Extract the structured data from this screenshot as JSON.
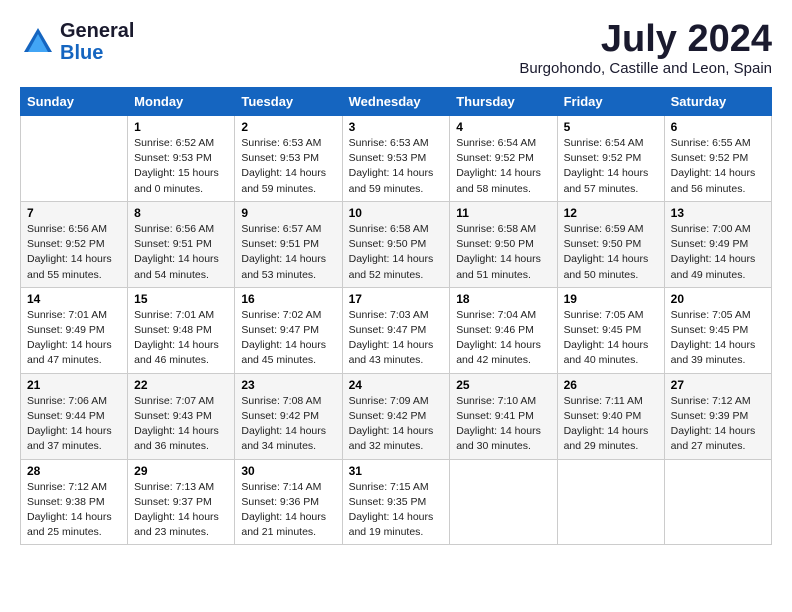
{
  "logo": {
    "general": "General",
    "blue": "Blue"
  },
  "title": "July 2024",
  "location": "Burgohondo, Castille and Leon, Spain",
  "days_header": [
    "Sunday",
    "Monday",
    "Tuesday",
    "Wednesday",
    "Thursday",
    "Friday",
    "Saturday"
  ],
  "weeks": [
    [
      {
        "day": "",
        "info": ""
      },
      {
        "day": "1",
        "info": "Sunrise: 6:52 AM\nSunset: 9:53 PM\nDaylight: 15 hours\nand 0 minutes."
      },
      {
        "day": "2",
        "info": "Sunrise: 6:53 AM\nSunset: 9:53 PM\nDaylight: 14 hours\nand 59 minutes."
      },
      {
        "day": "3",
        "info": "Sunrise: 6:53 AM\nSunset: 9:53 PM\nDaylight: 14 hours\nand 59 minutes."
      },
      {
        "day": "4",
        "info": "Sunrise: 6:54 AM\nSunset: 9:52 PM\nDaylight: 14 hours\nand 58 minutes."
      },
      {
        "day": "5",
        "info": "Sunrise: 6:54 AM\nSunset: 9:52 PM\nDaylight: 14 hours\nand 57 minutes."
      },
      {
        "day": "6",
        "info": "Sunrise: 6:55 AM\nSunset: 9:52 PM\nDaylight: 14 hours\nand 56 minutes."
      }
    ],
    [
      {
        "day": "7",
        "info": "Sunrise: 6:56 AM\nSunset: 9:52 PM\nDaylight: 14 hours\nand 55 minutes."
      },
      {
        "day": "8",
        "info": "Sunrise: 6:56 AM\nSunset: 9:51 PM\nDaylight: 14 hours\nand 54 minutes."
      },
      {
        "day": "9",
        "info": "Sunrise: 6:57 AM\nSunset: 9:51 PM\nDaylight: 14 hours\nand 53 minutes."
      },
      {
        "day": "10",
        "info": "Sunrise: 6:58 AM\nSunset: 9:50 PM\nDaylight: 14 hours\nand 52 minutes."
      },
      {
        "day": "11",
        "info": "Sunrise: 6:58 AM\nSunset: 9:50 PM\nDaylight: 14 hours\nand 51 minutes."
      },
      {
        "day": "12",
        "info": "Sunrise: 6:59 AM\nSunset: 9:50 PM\nDaylight: 14 hours\nand 50 minutes."
      },
      {
        "day": "13",
        "info": "Sunrise: 7:00 AM\nSunset: 9:49 PM\nDaylight: 14 hours\nand 49 minutes."
      }
    ],
    [
      {
        "day": "14",
        "info": "Sunrise: 7:01 AM\nSunset: 9:49 PM\nDaylight: 14 hours\nand 47 minutes."
      },
      {
        "day": "15",
        "info": "Sunrise: 7:01 AM\nSunset: 9:48 PM\nDaylight: 14 hours\nand 46 minutes."
      },
      {
        "day": "16",
        "info": "Sunrise: 7:02 AM\nSunset: 9:47 PM\nDaylight: 14 hours\nand 45 minutes."
      },
      {
        "day": "17",
        "info": "Sunrise: 7:03 AM\nSunset: 9:47 PM\nDaylight: 14 hours\nand 43 minutes."
      },
      {
        "day": "18",
        "info": "Sunrise: 7:04 AM\nSunset: 9:46 PM\nDaylight: 14 hours\nand 42 minutes."
      },
      {
        "day": "19",
        "info": "Sunrise: 7:05 AM\nSunset: 9:45 PM\nDaylight: 14 hours\nand 40 minutes."
      },
      {
        "day": "20",
        "info": "Sunrise: 7:05 AM\nSunset: 9:45 PM\nDaylight: 14 hours\nand 39 minutes."
      }
    ],
    [
      {
        "day": "21",
        "info": "Sunrise: 7:06 AM\nSunset: 9:44 PM\nDaylight: 14 hours\nand 37 minutes."
      },
      {
        "day": "22",
        "info": "Sunrise: 7:07 AM\nSunset: 9:43 PM\nDaylight: 14 hours\nand 36 minutes."
      },
      {
        "day": "23",
        "info": "Sunrise: 7:08 AM\nSunset: 9:42 PM\nDaylight: 14 hours\nand 34 minutes."
      },
      {
        "day": "24",
        "info": "Sunrise: 7:09 AM\nSunset: 9:42 PM\nDaylight: 14 hours\nand 32 minutes."
      },
      {
        "day": "25",
        "info": "Sunrise: 7:10 AM\nSunset: 9:41 PM\nDaylight: 14 hours\nand 30 minutes."
      },
      {
        "day": "26",
        "info": "Sunrise: 7:11 AM\nSunset: 9:40 PM\nDaylight: 14 hours\nand 29 minutes."
      },
      {
        "day": "27",
        "info": "Sunrise: 7:12 AM\nSunset: 9:39 PM\nDaylight: 14 hours\nand 27 minutes."
      }
    ],
    [
      {
        "day": "28",
        "info": "Sunrise: 7:12 AM\nSunset: 9:38 PM\nDaylight: 14 hours\nand 25 minutes."
      },
      {
        "day": "29",
        "info": "Sunrise: 7:13 AM\nSunset: 9:37 PM\nDaylight: 14 hours\nand 23 minutes."
      },
      {
        "day": "30",
        "info": "Sunrise: 7:14 AM\nSunset: 9:36 PM\nDaylight: 14 hours\nand 21 minutes."
      },
      {
        "day": "31",
        "info": "Sunrise: 7:15 AM\nSunset: 9:35 PM\nDaylight: 14 hours\nand 19 minutes."
      },
      {
        "day": "",
        "info": ""
      },
      {
        "day": "",
        "info": ""
      },
      {
        "day": "",
        "info": ""
      }
    ]
  ]
}
